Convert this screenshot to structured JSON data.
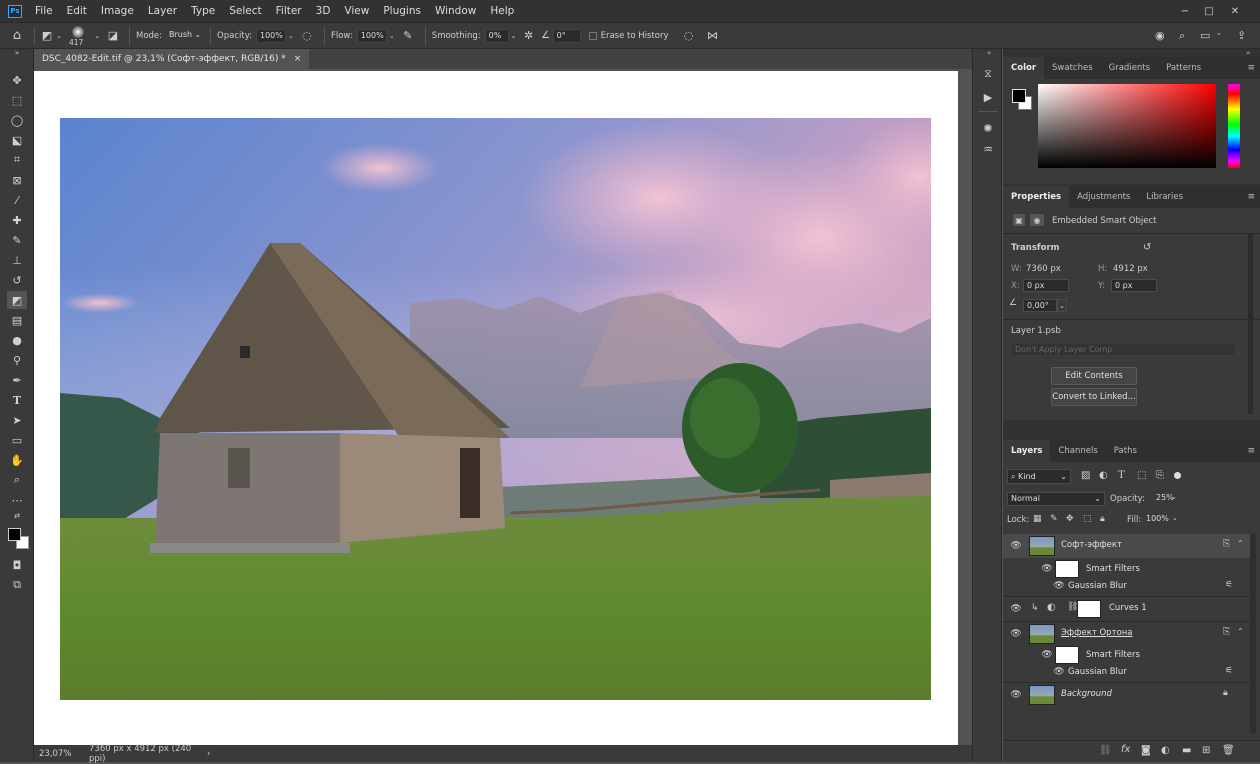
{
  "menu": {
    "logo": "Ps",
    "items": [
      "File",
      "Edit",
      "Image",
      "Layer",
      "Type",
      "Select",
      "Filter",
      "3D",
      "View",
      "Plugins",
      "Window",
      "Help"
    ]
  },
  "window_controls": {
    "minimize": "−",
    "maximize": "□",
    "close": "✕"
  },
  "options": {
    "brush_size": "417",
    "mode_label": "Mode:",
    "mode_value": "Brush",
    "opacity_label": "Opacity:",
    "opacity_value": "100%",
    "flow_label": "Flow:",
    "flow_value": "100%",
    "smoothing_label": "Smoothing:",
    "smoothing_value": "0%",
    "angle_value": "0°",
    "erase_history_label": "Erase to History"
  },
  "document": {
    "tab_title": "DSC_4082-Edit.tif @ 23,1% (Софт-эффект, RGB/16) *",
    "close": "×"
  },
  "status": {
    "zoom": "23,07%",
    "info": "7360 px x 4912 px (240 ppi)",
    "arrow": "›"
  },
  "color_panel": {
    "tabs": [
      "Color",
      "Swatches",
      "Gradients",
      "Patterns"
    ],
    "active_tab": "Color",
    "foreground": "#000000",
    "background": "#ffffff",
    "hue": "#ff0000"
  },
  "properties_panel": {
    "tabs": [
      "Properties",
      "Adjustments",
      "Libraries"
    ],
    "active_tab": "Properties",
    "object_type": "Embedded Smart Object",
    "transform_label": "Transform",
    "w_label": "W:",
    "w_value": "7360 px",
    "h_label": "H:",
    "h_value": "4912 px",
    "x_label": "X:",
    "x_value": "0 px",
    "y_label": "Y:",
    "y_value": "0 px",
    "angle_value": "0,00°",
    "linked_file": "Layer 1.psb",
    "layer_comp_placeholder": "Don't Apply Layer Comp",
    "edit_contents_label": "Edit Contents",
    "convert_label": "Convert to Linked..."
  },
  "layers_panel": {
    "tabs": [
      "Layers",
      "Channels",
      "Paths"
    ],
    "active_tab": "Layers",
    "filter_kind": "Kind",
    "blend_mode": "Normal",
    "opacity_label": "Opacity:",
    "opacity_value": "25%",
    "lock_label": "Lock:",
    "fill_label": "Fill:",
    "fill_value": "100%",
    "layers": [
      {
        "name": "Софт-эффект",
        "smart_filters": "Smart Filters",
        "filter": "Gaussian Blur"
      },
      {
        "name": "Curves 1"
      },
      {
        "name": "Эффект Ортона",
        "smart_filters": "Smart Filters",
        "filter": "Gaussian Blur"
      },
      {
        "name": "Background"
      }
    ],
    "footer_icons": [
      "link-icon",
      "fx-icon",
      "mask-icon",
      "adjustment-icon",
      "group-icon",
      "new-layer-icon",
      "trash-icon"
    ]
  }
}
